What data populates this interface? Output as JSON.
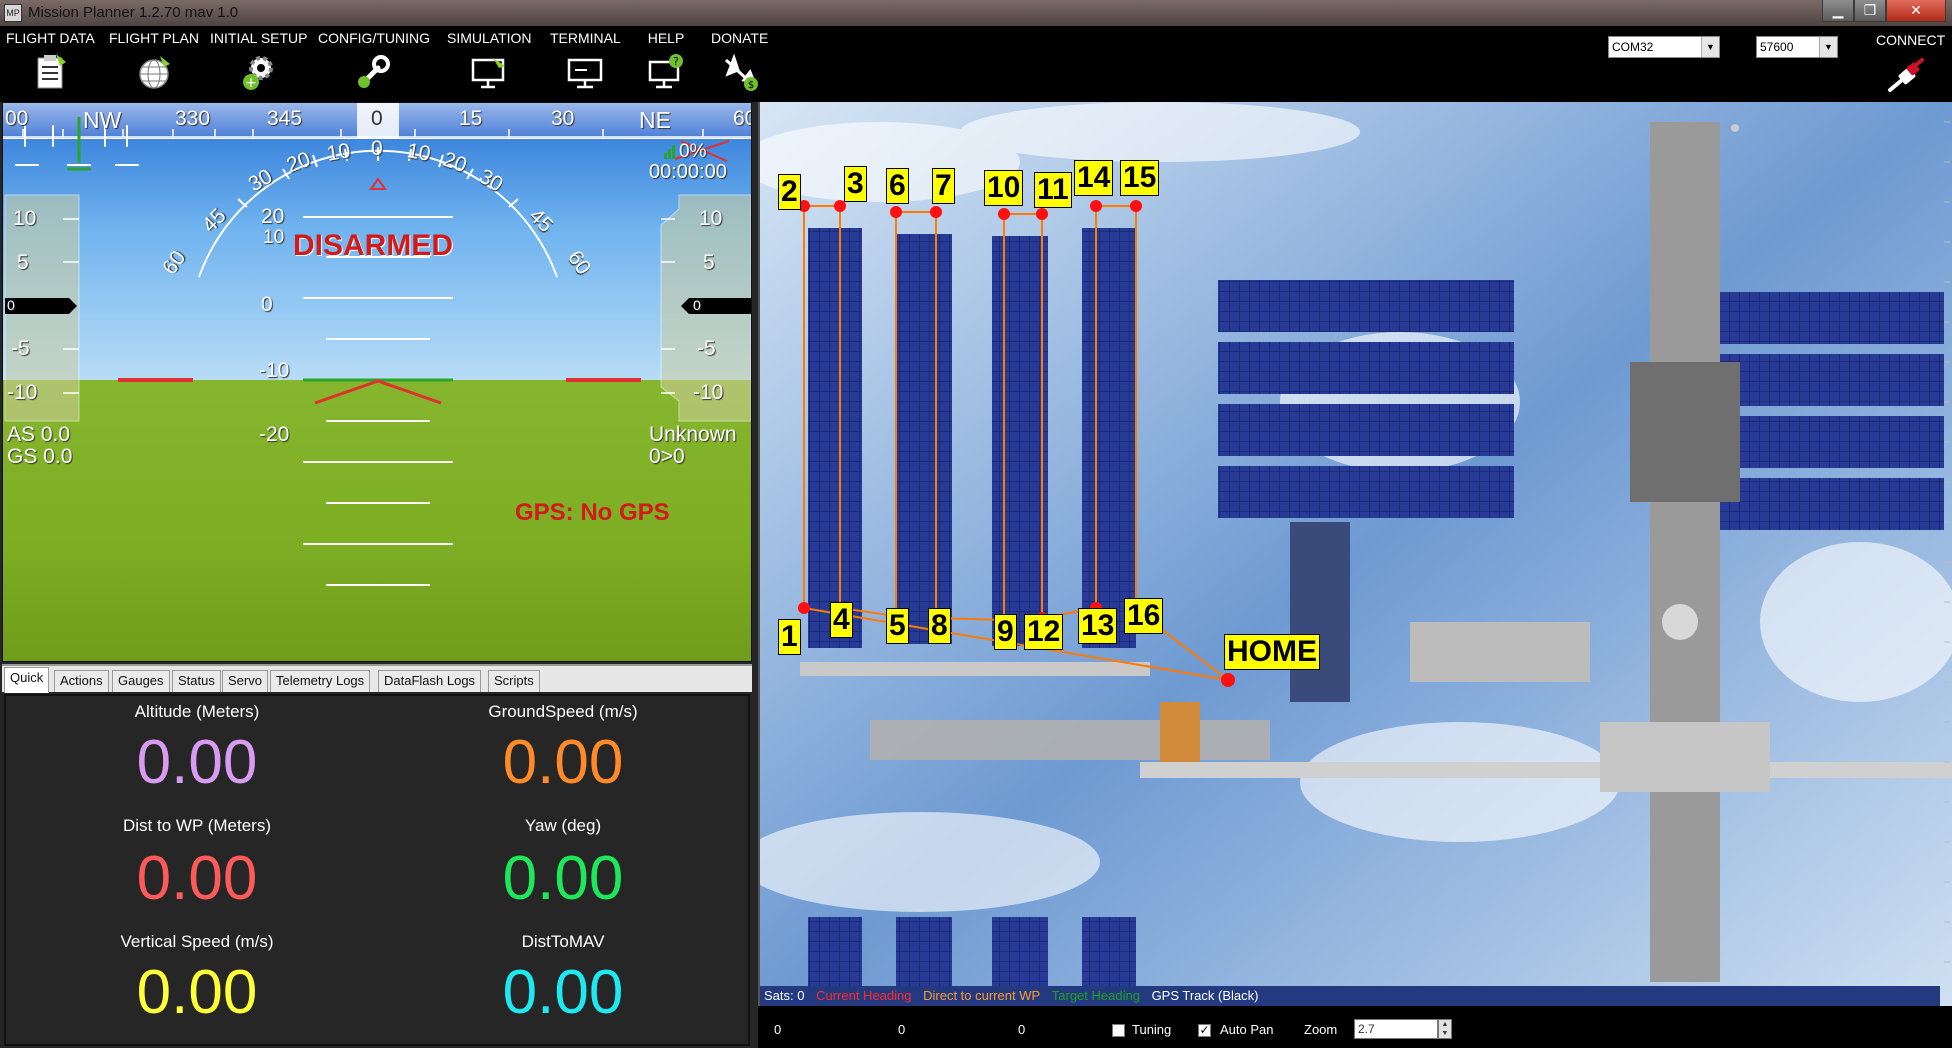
{
  "window": {
    "title": "Mission Planner 1.2.70 mav 1.0",
    "app_icon": "MP"
  },
  "menu": [
    {
      "label": "FLIGHT DATA",
      "icon": "clipboard-icon"
    },
    {
      "label": "FLIGHT PLAN",
      "icon": "globe-icon"
    },
    {
      "label": "INITIAL SETUP",
      "icon": "gears-icon"
    },
    {
      "label": "CONFIG/TUNING",
      "icon": "wrench-icon"
    },
    {
      "label": "SIMULATION",
      "icon": "monitor-plane-icon"
    },
    {
      "label": "TERMINAL",
      "icon": "terminal-icon"
    },
    {
      "label": "HELP",
      "icon": "help-monitor-icon"
    },
    {
      "label": "DONATE",
      "icon": "plane-dollar-icon"
    }
  ],
  "connection": {
    "port": "COM32",
    "baud": "57600",
    "connect_label": "CONNECT"
  },
  "hud": {
    "heading_ticks": [
      "00",
      "NW",
      "330",
      "345",
      "0",
      "15",
      "30",
      "NE",
      "60"
    ],
    "roll_labels": [
      "60",
      "45",
      "30",
      "20",
      "10",
      "0",
      "10",
      "20",
      "30",
      "45",
      "60"
    ],
    "pitch_labels": [
      "20",
      "10",
      "0",
      "-10",
      "-20"
    ],
    "left_tape": [
      "10",
      "5",
      "0",
      "-5",
      "-10"
    ],
    "right_tape": [
      "10",
      "5",
      "0",
      "-5",
      "-10"
    ],
    "left_tape_value": "0",
    "right_tape_value": "0",
    "battery": "0%",
    "timer": "00:00:00",
    "status": "DISARMED",
    "airspeed": "AS 0.0",
    "groundspeed": "GS 0.0",
    "mode": "Unknown",
    "wp": "0>0",
    "gps": "GPS: No GPS"
  },
  "tabs": [
    "Quick",
    "Actions",
    "Gauges",
    "Status",
    "Servo",
    "Telemetry Logs",
    "DataFlash Logs",
    "Scripts"
  ],
  "quick": [
    {
      "label": "Altitude (Meters)",
      "value": "0.00",
      "color": "#d79cf2"
    },
    {
      "label": "GroundSpeed (m/s)",
      "value": "0.00",
      "color": "#ff8a2a"
    },
    {
      "label": "Dist to WP (Meters)",
      "value": "0.00",
      "color": "#ff5a5a"
    },
    {
      "label": "Yaw (deg)",
      "value": "0.00",
      "color": "#1ee85a"
    },
    {
      "label": "Vertical Speed (m/s)",
      "value": "0.00",
      "color": "#ffff3a"
    },
    {
      "label": "DistToMAV",
      "value": "0.00",
      "color": "#1ee8f0"
    }
  ],
  "map": {
    "waypoints": [
      "1",
      "2",
      "3",
      "4",
      "5",
      "6",
      "7",
      "8",
      "9",
      "10",
      "11",
      "12",
      "13",
      "14",
      "15",
      "16"
    ],
    "home_label": "HOME",
    "legend": {
      "sats": "Sats: 0",
      "current_heading": "Current Heading",
      "direct_wp": "Direct to current WP",
      "target_heading": "Target Heading",
      "gps_track": "GPS Track (Black)"
    }
  },
  "bottom": {
    "v1": "0",
    "v2": "0",
    "v3": "0",
    "tuning": "Tuning",
    "autopan": "Auto Pan",
    "zoom_label": "Zoom",
    "zoom_value": "2.7",
    "autopan_checked": "✓"
  }
}
